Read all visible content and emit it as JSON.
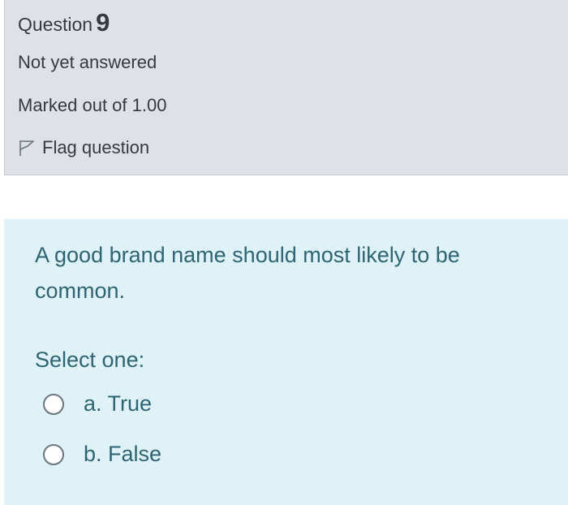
{
  "info": {
    "question_word": "Question",
    "question_number": "9",
    "status": "Not yet answered",
    "marks": "Marked out of 1.00",
    "flag_label": "Flag question",
    "flag_icon": "flag-outline-icon"
  },
  "question": {
    "text": "A good brand name should most likely to be common.",
    "prompt": "Select one:",
    "options": [
      {
        "label": "a. True",
        "selected": false
      },
      {
        "label": "b. False",
        "selected": false
      }
    ]
  },
  "colors": {
    "info_background": "#dee2e6",
    "content_background": "#def2f8",
    "content_text": "#2f6473",
    "info_text": "#343a40"
  }
}
